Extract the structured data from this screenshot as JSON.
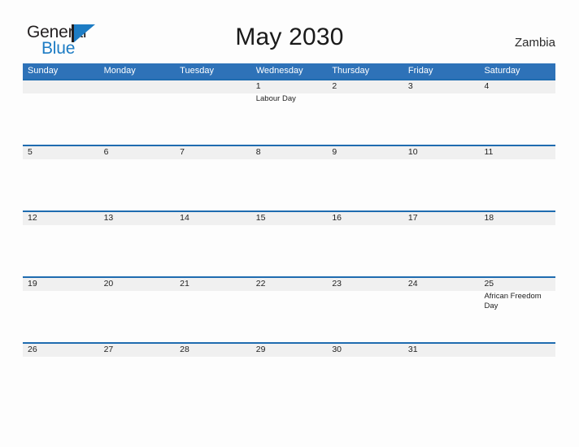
{
  "brand": {
    "name_part1": "General",
    "name_part2": "Blue",
    "logo_icon": "triangle-flag-icon",
    "accent_color": "#1d7cc4"
  },
  "header": {
    "title": "May 2030",
    "location": "Zambia"
  },
  "theme": {
    "header_blue": "#2e72b8",
    "row_rule_blue": "#1f6cb0",
    "band_gray": "#f0f0f0",
    "page_background": "#fdfdfd",
    "text_color": "#222222"
  },
  "calendar": {
    "month": "May",
    "year": "2030",
    "day_headers": [
      "Sunday",
      "Monday",
      "Tuesday",
      "Wednesday",
      "Thursday",
      "Friday",
      "Saturday"
    ],
    "weeks": [
      {
        "band_columns": 7,
        "days": [
          {
            "num": "",
            "event": ""
          },
          {
            "num": "",
            "event": ""
          },
          {
            "num": "",
            "event": ""
          },
          {
            "num": "1",
            "event": "Labour Day"
          },
          {
            "num": "2",
            "event": ""
          },
          {
            "num": "3",
            "event": ""
          },
          {
            "num": "4",
            "event": ""
          }
        ]
      },
      {
        "band_columns": 7,
        "days": [
          {
            "num": "5",
            "event": ""
          },
          {
            "num": "6",
            "event": ""
          },
          {
            "num": "7",
            "event": ""
          },
          {
            "num": "8",
            "event": ""
          },
          {
            "num": "9",
            "event": ""
          },
          {
            "num": "10",
            "event": ""
          },
          {
            "num": "11",
            "event": ""
          }
        ]
      },
      {
        "band_columns": 7,
        "days": [
          {
            "num": "12",
            "event": ""
          },
          {
            "num": "13",
            "event": ""
          },
          {
            "num": "14",
            "event": ""
          },
          {
            "num": "15",
            "event": ""
          },
          {
            "num": "16",
            "event": ""
          },
          {
            "num": "17",
            "event": ""
          },
          {
            "num": "18",
            "event": ""
          }
        ]
      },
      {
        "band_columns": 7,
        "days": [
          {
            "num": "19",
            "event": ""
          },
          {
            "num": "20",
            "event": ""
          },
          {
            "num": "21",
            "event": ""
          },
          {
            "num": "22",
            "event": ""
          },
          {
            "num": "23",
            "event": ""
          },
          {
            "num": "24",
            "event": ""
          },
          {
            "num": "25",
            "event": "African Freedom Day"
          }
        ]
      },
      {
        "band_columns": 7,
        "days": [
          {
            "num": "26",
            "event": ""
          },
          {
            "num": "27",
            "event": ""
          },
          {
            "num": "28",
            "event": ""
          },
          {
            "num": "29",
            "event": ""
          },
          {
            "num": "30",
            "event": ""
          },
          {
            "num": "31",
            "event": ""
          },
          {
            "num": "",
            "event": ""
          }
        ]
      }
    ]
  }
}
